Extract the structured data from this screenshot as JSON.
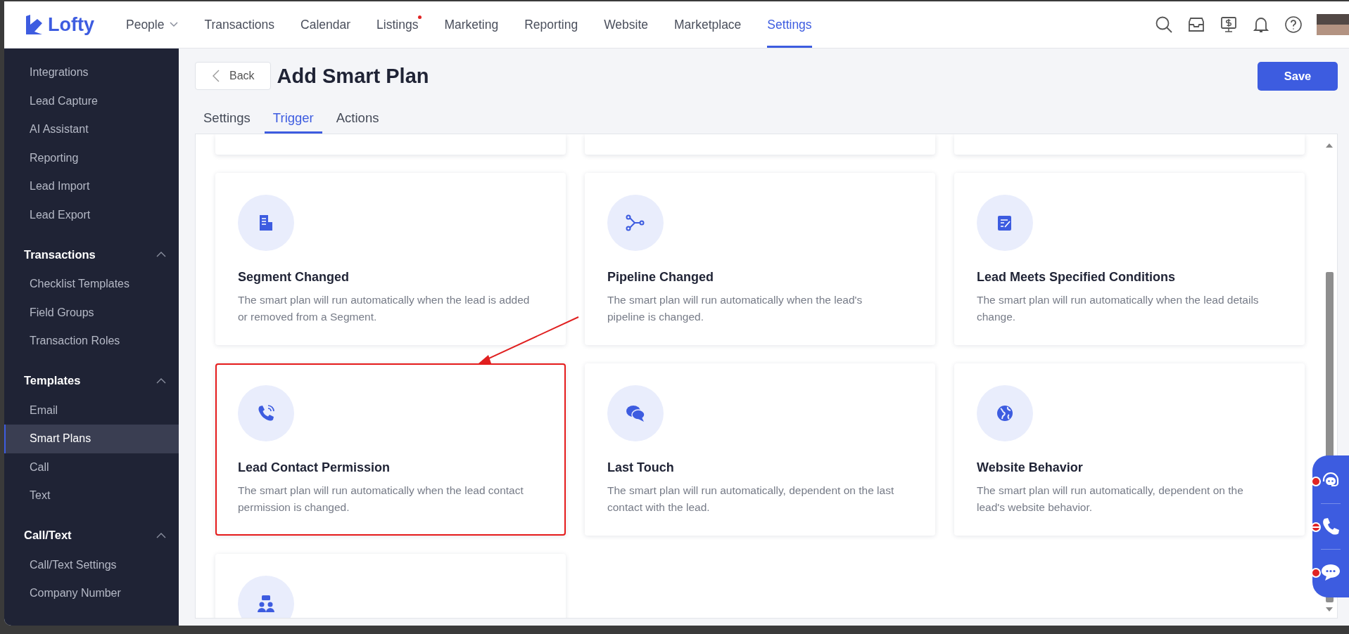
{
  "brand": {
    "name": "Lofty"
  },
  "nav": [
    {
      "label": "People",
      "selected": false,
      "dropdown": true,
      "dot": false
    },
    {
      "label": "Transactions",
      "selected": false,
      "dropdown": false,
      "dot": false
    },
    {
      "label": "Calendar",
      "selected": false,
      "dropdown": false,
      "dot": false
    },
    {
      "label": "Listings",
      "selected": false,
      "dropdown": false,
      "dot": true
    },
    {
      "label": "Marketing",
      "selected": false,
      "dropdown": false,
      "dot": false
    },
    {
      "label": "Reporting",
      "selected": false,
      "dropdown": false,
      "dot": false
    },
    {
      "label": "Website",
      "selected": false,
      "dropdown": false,
      "dot": false
    },
    {
      "label": "Marketplace",
      "selected": false,
      "dropdown": false,
      "dot": false
    },
    {
      "label": "Settings",
      "selected": true,
      "dropdown": false,
      "dot": false
    }
  ],
  "sidebar": {
    "items": [
      {
        "label": "Integrations",
        "selected": false
      },
      {
        "label": "Lead Capture",
        "selected": false
      },
      {
        "label": "AI Assistant",
        "selected": false
      },
      {
        "label": "Reporting",
        "selected": false
      },
      {
        "label": "Lead Import",
        "selected": false
      },
      {
        "label": "Lead Export",
        "selected": false
      }
    ],
    "sections": [
      {
        "title": "Transactions",
        "expanded": true,
        "items": [
          {
            "label": "Checklist Templates",
            "selected": false
          },
          {
            "label": "Field Groups",
            "selected": false
          },
          {
            "label": "Transaction Roles",
            "selected": false
          }
        ]
      },
      {
        "title": "Templates",
        "expanded": true,
        "items": [
          {
            "label": "Email",
            "selected": false
          },
          {
            "label": "Smart Plans",
            "selected": true
          },
          {
            "label": "Call",
            "selected": false
          },
          {
            "label": "Text",
            "selected": false
          }
        ]
      },
      {
        "title": "Call/Text",
        "expanded": true,
        "items": [
          {
            "label": "Call/Text Settings",
            "selected": false
          },
          {
            "label": "Company Number",
            "selected": false
          }
        ]
      }
    ]
  },
  "header": {
    "back": "Back",
    "title": "Add Smart Plan",
    "save": "Save"
  },
  "tabs": [
    {
      "label": "Settings",
      "selected": false
    },
    {
      "label": "Trigger",
      "selected": true
    },
    {
      "label": "Actions",
      "selected": false
    }
  ],
  "cards": [
    {
      "title": "Segment Changed",
      "description": "The smart plan will run automatically when the lead is added or removed from a Segment.",
      "highlighted": false
    },
    {
      "title": "Pipeline Changed",
      "description": "The smart plan will run automatically when the lead's pipeline is changed.",
      "highlighted": false
    },
    {
      "title": "Lead Meets Specified Conditions",
      "description": "The smart plan will run automatically when the lead details change.",
      "highlighted": false
    },
    {
      "title": "Lead Contact Permission",
      "description": "The smart plan will run automatically when the lead contact permission is changed.",
      "highlighted": true
    },
    {
      "title": "Last Touch",
      "description": "The smart plan will run automatically, dependent on the last contact with the lead.",
      "highlighted": false
    },
    {
      "title": "Website Behavior",
      "description": "The smart plan will run automatically, dependent on the lead's website behavior.",
      "highlighted": false
    },
    {
      "highlighted": false
    }
  ]
}
